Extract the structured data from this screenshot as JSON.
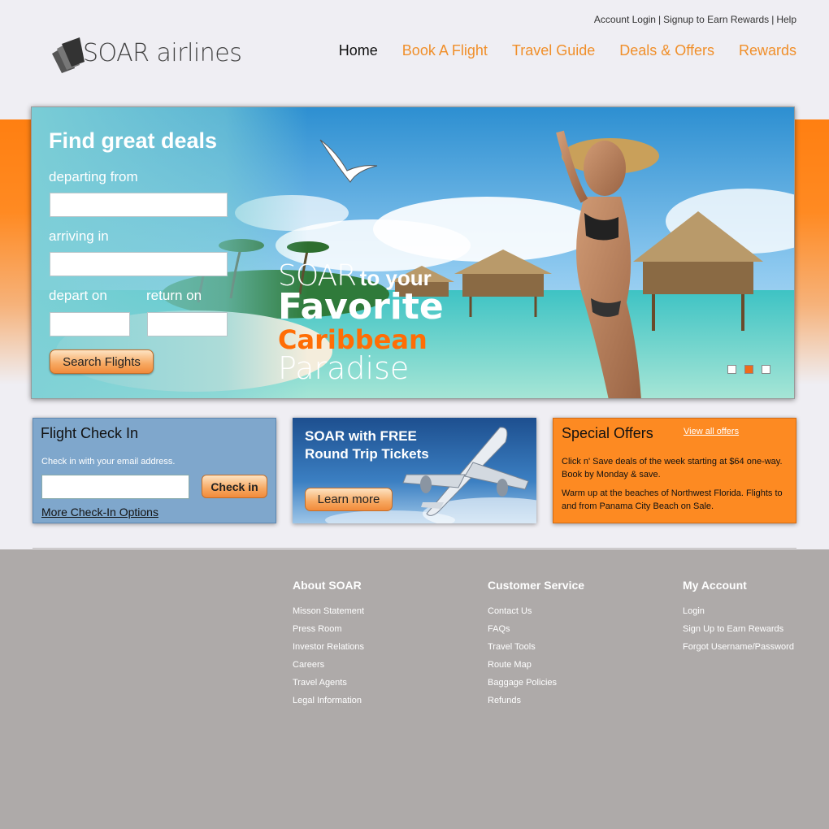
{
  "top_links": {
    "account_login": "Account Login",
    "signup": "Signup to Earn Rewards",
    "help": "Help",
    "sep": "|"
  },
  "brand": {
    "name": "SOAR airlines"
  },
  "nav": {
    "home": "Home",
    "book": "Book A Flight",
    "travel_guide": "Travel Guide",
    "deals": "Deals & Offers",
    "rewards": "Rewards"
  },
  "hero": {
    "title": "Find great deals",
    "departing_label": "departing from",
    "arriving_label": "arriving in",
    "depart_on_label": "depart on",
    "return_on_label": "return on",
    "departing_value": "",
    "arriving_value": "",
    "depart_on_value": "",
    "return_on_value": "",
    "search_button": "Search Flights",
    "slogan_soar": "SOAR",
    "slogan_to_your": "to your",
    "slogan_favorite": "Favorite",
    "slogan_caribbean": "Caribbean",
    "slogan_paradise": "Paradise",
    "active_slide": 2,
    "slide_count": 3
  },
  "checkin": {
    "title": "Flight Check In",
    "subtitle": "Check in with your email address.",
    "email_value": "",
    "button": "Check in",
    "more": "More Check-In Options"
  },
  "promo": {
    "line1": "SOAR with FREE",
    "line2": "Round Trip Tickets",
    "button": "Learn more"
  },
  "offers": {
    "title": "Special Offers",
    "view_all": "View all offers",
    "p1": "Click n' Save deals of the week starting at $64 one-way. Book by Monday & save.",
    "p2": "Warm up at the beaches of Northwest Florida. Flights to and from Panama City Beach on Sale."
  },
  "footer": {
    "about": {
      "title": "About SOAR",
      "items": [
        "Misson Statement",
        "Press Room",
        "Investor Relations",
        "Careers",
        "Travel Agents",
        "Legal Information"
      ]
    },
    "service": {
      "title": "Customer Service",
      "items": [
        "Contact Us",
        "FAQs",
        "Travel Tools",
        "Route Map",
        "Baggage Policies",
        "Refunds"
      ]
    },
    "account": {
      "title": "My Account",
      "items": [
        "Login",
        "Sign Up to Earn Rewards",
        "Forgot Username/Password"
      ]
    }
  },
  "colors": {
    "accent": "#f08f2a",
    "orange_band": "#ff7f11",
    "checkin_blue": "#7fa7cc",
    "offers_orange": "#fd8a22",
    "footer_gray": "#aeaaa9",
    "page_bg": "#efeef3"
  }
}
